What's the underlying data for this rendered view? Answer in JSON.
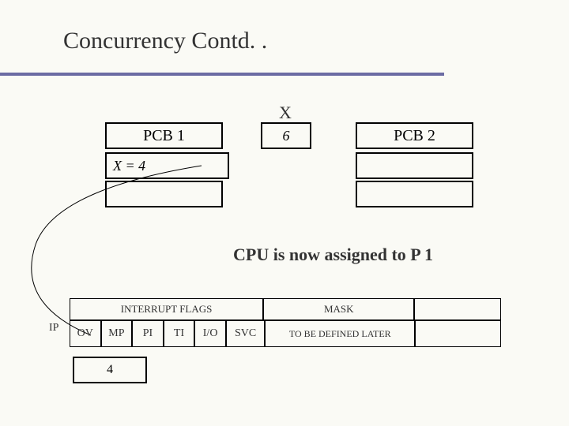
{
  "title": "Concurrency Contd. .",
  "x_label": "X",
  "x_value": "6",
  "pcb1": {
    "label": "PCB 1",
    "row1": "X = 4",
    "row2": ""
  },
  "pcb2": {
    "label": "PCB 2",
    "row1": "",
    "row2": ""
  },
  "caption": "CPU is now assigned to P 1",
  "table": {
    "hdr_flags": "INTERRUPT FLAGS",
    "hdr_mask": "MASK",
    "cells": {
      "ov": "OV",
      "mp": "MP",
      "pi": "PI",
      "ti": "TI",
      "io": "I/O",
      "svc": "SVC",
      "mask": "TO BE DEFINED LATER"
    }
  },
  "ip_label": "IP",
  "ip_value": "4"
}
